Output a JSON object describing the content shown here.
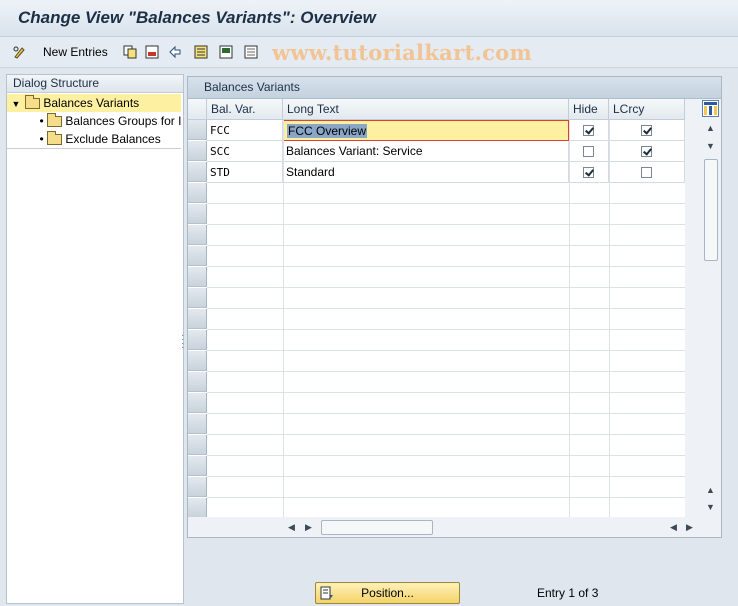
{
  "title": "Change View \"Balances Variants\": Overview",
  "toolbar": {
    "new_entries_label": "New Entries",
    "watermark": "www.tutorialkart.com"
  },
  "tree": {
    "header": "Dialog Structure",
    "items": [
      {
        "label": "Balances Variants",
        "level": 0,
        "selected": true
      },
      {
        "label": "Balances Groups for I",
        "level": 1,
        "selected": false
      },
      {
        "label": "Exclude Balances",
        "level": 1,
        "selected": false
      }
    ]
  },
  "panel": {
    "title": "Balances Variants",
    "columns": [
      "Bal. Var.",
      "Long Text",
      "Hide",
      "LCrcy"
    ],
    "rows": [
      {
        "bal_var": "FCC",
        "long_text": "FCC Overview",
        "hide": true,
        "lcrcy": true
      },
      {
        "bal_var": "SCC",
        "long_text": "Balances Variant: Service",
        "hide": false,
        "lcrcy": true
      },
      {
        "bal_var": "STD",
        "long_text": "Standard",
        "hide": true,
        "lcrcy": false
      }
    ]
  },
  "footer": {
    "position_label": "Position...",
    "entry_text": "Entry 1 of 3"
  },
  "colors": {
    "selected_row": "#fdf0a0",
    "position_button": "#f3d36a",
    "watermark": "#f2c495"
  }
}
